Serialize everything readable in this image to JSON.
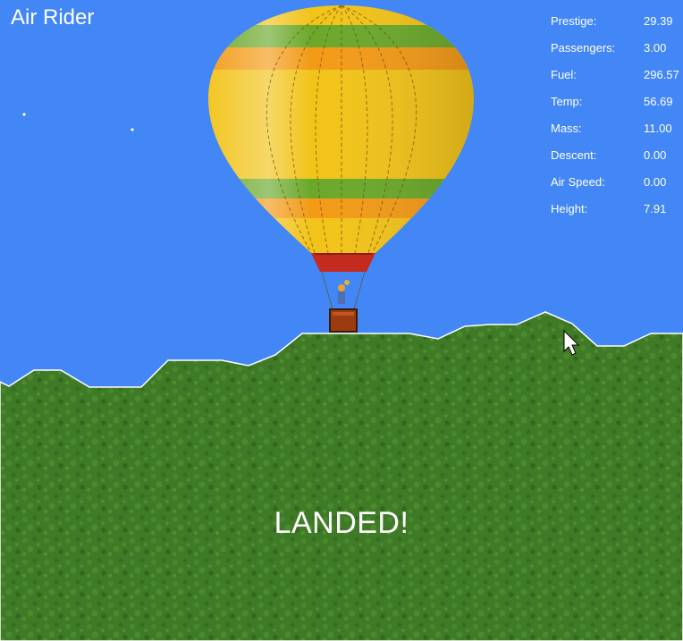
{
  "game": {
    "title": "Air Rider",
    "status_message": "LANDED!"
  },
  "stats": [
    {
      "label": "Prestige:",
      "value": "29.39"
    },
    {
      "label": "Passengers:",
      "value": "3.00"
    },
    {
      "label": "Fuel:",
      "value": "296.57"
    },
    {
      "label": "Temp:",
      "value": "56.69"
    },
    {
      "label": "Mass:",
      "value": "11.00"
    },
    {
      "label": "Descent:",
      "value": "0.00"
    },
    {
      "label": "Air Speed:",
      "value": "0.00"
    },
    {
      "label": "Height:",
      "value": "7.91"
    }
  ],
  "colors": {
    "sky": "#4287f5",
    "grass": "#3f7a26",
    "balloon_yellow": "#f2c318",
    "balloon_green": "#6aa82a",
    "balloon_orange": "#f39a16",
    "skirt_red": "#c42a1e",
    "basket": "#9a3b12",
    "text": "#ffffff"
  },
  "icons": [
    "mouse-pointer-icon"
  ]
}
